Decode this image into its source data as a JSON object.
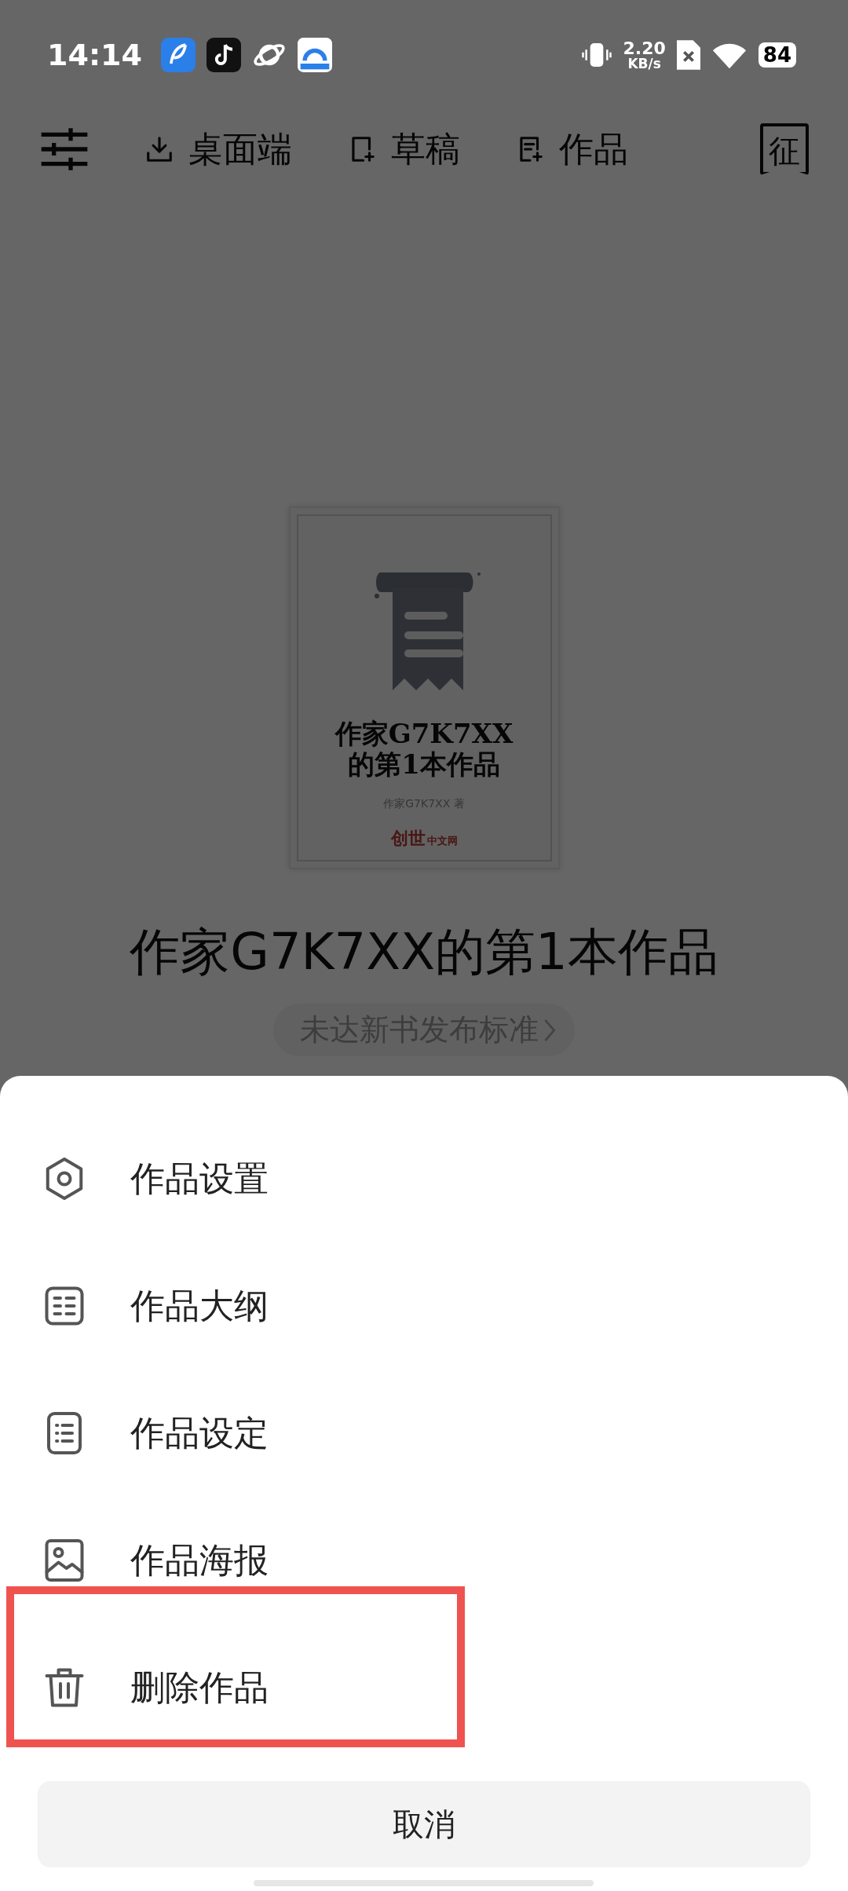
{
  "status_bar": {
    "time": "14:14",
    "net_speed": "2.20",
    "net_unit": "KB/s",
    "battery": "84"
  },
  "toolbar": {
    "items": [
      {
        "kind": "download",
        "label": "桌面端"
      },
      {
        "kind": "draft",
        "label": "草稿"
      },
      {
        "kind": "works",
        "label": "作品"
      }
    ],
    "badge_char": "征"
  },
  "book": {
    "cover": {
      "title_lines": [
        "作家G7K7XX",
        "的第1本作品"
      ],
      "author": "作家G7K7XX 著",
      "publisher_main": "创世",
      "publisher_sub": "中文网"
    },
    "title": "作家G7K7XX的第1本作品",
    "status": "未达新书发布标准"
  },
  "sheet": {
    "items": [
      {
        "kind": "settings",
        "label": "作品设置",
        "highlighted": false
      },
      {
        "kind": "outline",
        "label": "作品大纲",
        "highlighted": false
      },
      {
        "kind": "list",
        "label": "作品设定",
        "highlighted": false
      },
      {
        "kind": "poster",
        "label": "作品海报",
        "highlighted": false
      },
      {
        "kind": "delete",
        "label": "删除作品",
        "highlighted": true
      }
    ],
    "cancel": "取消"
  }
}
